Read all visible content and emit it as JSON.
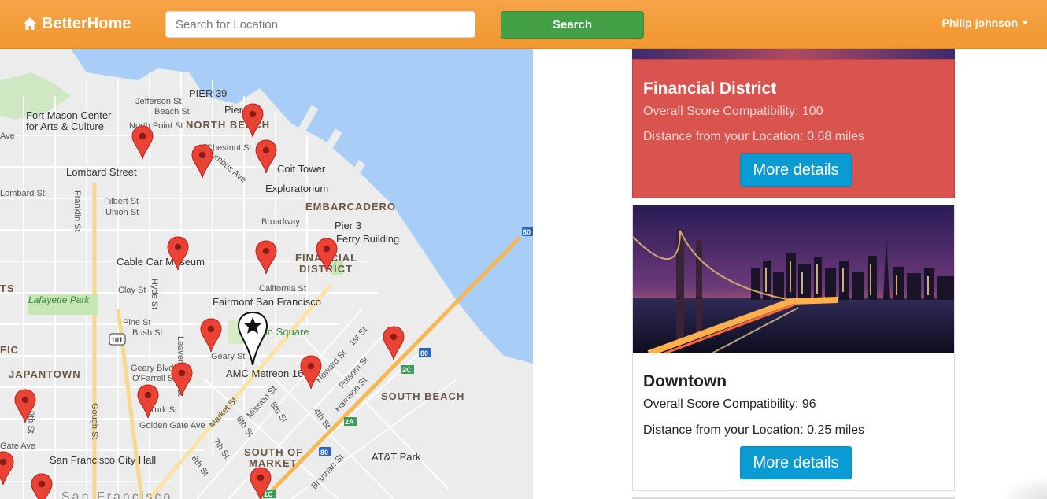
{
  "navbar": {
    "brand": "BetterHome",
    "brand_icon": "home-icon",
    "search_placeholder": "Search for Location",
    "search_label": "Search",
    "user_name": "Philip johnson",
    "colors": {
      "bar": "#f09830",
      "search_button": "#43a047"
    }
  },
  "map": {
    "labels": {
      "pier39": "PIER 39",
      "fort_mason_1": "Fort Mason Center",
      "fort_mason_2": "for Arts & Culture",
      "jefferson": "Jefferson St",
      "beach": "Beach St",
      "north_point": "North Point St",
      "pier": "Pier",
      "north_beach": "NORTH BEACH",
      "chestnut": "Chestnut St",
      "lombard": "Lombard Street",
      "lombard_st": "Lombard St",
      "coit": "Coit Tower",
      "exploratorium": "Exploratorium",
      "columbus": "Columbus Ave",
      "filbert": "Filbert St",
      "union": "Union St",
      "franklin": "Franklin St",
      "embarcadero": "EMBARCADERO",
      "broadway": "Broadway",
      "pier3": "Pier 3",
      "ferry": "Ferry Building",
      "cable_car": "Cable Car Museum",
      "financial_1": "FINANCIAL",
      "financial_2": "DISTRICT",
      "california": "California St",
      "clay": "Clay St",
      "hyde": "Hyde St",
      "lafayette": "Lafayette Park",
      "fairmont": "Fairmont San Francisco",
      "pine": "Pine St",
      "bush": "Bush St",
      "union_square": "Union Square",
      "leavenworth": "Leavenworth St",
      "geary": "Geary St",
      "geary_blvd": "Geary Blvd",
      "ofarrell": "O'Farrell St",
      "japantown": "JAPANTOWN",
      "amc": "AMC Metreon 16",
      "howard": "Howard St",
      "folsom": "Folsom St",
      "harrison": "Harrison St",
      "first": "1st St",
      "south_beach": "SOUTH BEACH",
      "turk": "Turk St",
      "golden_gate": "Golden Gate Ave",
      "gough": "Gough St",
      "market": "Market St",
      "mission": "Mission St",
      "fifth": "5th St",
      "sixth": "6th St",
      "fourth": "4th St",
      "seventh": "7th St",
      "eighth": "8th St",
      "soma_1": "SOUTH OF",
      "soma_2": "MARKET",
      "city_hall": "San Francisco City Hall",
      "att": "AT&T Park",
      "brannan": "Brannan St",
      "fic": "FIC",
      "ts": "TS",
      "ave": "Ave",
      "gate_ave": "Gate Ave",
      "st9": "9th St",
      "sf": "San Francisco",
      "hwy80a": "80",
      "hwy80b": "80",
      "hwy80c": "80",
      "hwy101": "101",
      "s2c": "2C",
      "s2a": "2A",
      "s1c": "1C"
    }
  },
  "cards": [
    {
      "name": "Financial District",
      "score_text": "Overall Score Compatibility: 100",
      "distance_text": "Distance from your Location: 0.68 miles",
      "button": "More details",
      "color": "#d9534f"
    },
    {
      "name": "Downtown",
      "score_text": "Overall Score Compatibility: 96",
      "distance_text": "Distance from your Location: 0.25 miles",
      "button": "More details",
      "image": "bay-bridge-night-photo"
    }
  ]
}
